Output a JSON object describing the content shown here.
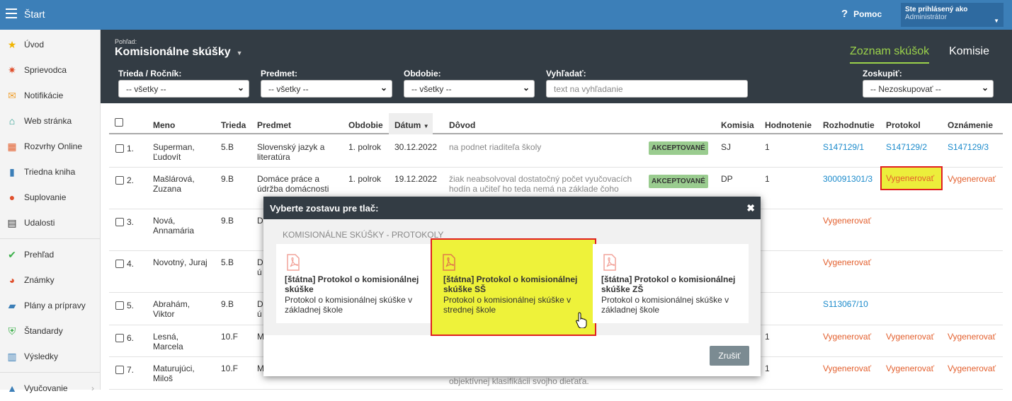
{
  "topbar": {
    "title": "Štart",
    "help": "Pomoc",
    "user_label": "Ste prihlásený ako",
    "user_name": "Administrátor"
  },
  "sidebar": {
    "items": [
      {
        "label": "Úvod",
        "icon": "star-icon",
        "color": "#f0b400"
      },
      {
        "label": "Sprievodca",
        "icon": "magic-wand-icon",
        "color": "#e0502d"
      },
      {
        "label": "Notifikácie",
        "icon": "envelope-icon",
        "color": "#f0a030"
      },
      {
        "label": "Web stránka",
        "icon": "home-icon",
        "color": "#2a9d8f"
      },
      {
        "label": "Rozvrhy Online",
        "icon": "calendar-grid-icon",
        "color": "#e35f2d"
      },
      {
        "label": "Triedna kniha",
        "icon": "book-icon",
        "color": "#3c7fb8"
      },
      {
        "label": "Suplovanie",
        "icon": "user-icon",
        "color": "#e0502d"
      },
      {
        "label": "Udalosti",
        "icon": "calendar-icon",
        "color": "#333333"
      },
      {
        "label": "Prehľad",
        "icon": "check-circle-icon",
        "color": "#3cb04a"
      },
      {
        "label": "Známky",
        "icon": "chart-circle-icon",
        "color": "#e0502d"
      },
      {
        "label": "Plány a prípravy",
        "icon": "briefcase-icon",
        "color": "#3c7fb8"
      },
      {
        "label": "Štandardy",
        "icon": "shield-check-icon",
        "color": "#3cb04a"
      },
      {
        "label": "Výsledky",
        "icon": "bar-chart-icon",
        "color": "#3c7fb8"
      },
      {
        "label": "Vyučovanie",
        "icon": "school-icon",
        "color": "#3c7fb8"
      }
    ]
  },
  "header": {
    "view_label": "Pohľad:",
    "view_title": "Komisionálne skúšky",
    "tabs": [
      "Zoznam skúšok",
      "Komisie"
    ]
  },
  "filters": {
    "class_label": "Trieda / Ročník:",
    "class_value": "-- všetky --",
    "subject_label": "Predmet:",
    "subject_value": "-- všetky --",
    "period_label": "Obdobie:",
    "period_value": "-- všetky --",
    "search_label": "Vyhľadať:",
    "search_placeholder": "text na vyhľadanie",
    "group_label": "Zoskupiť:",
    "group_value": "-- Nezoskupovať --"
  },
  "table": {
    "headers": {
      "name": "Meno",
      "class": "Trieda",
      "subject": "Predmet",
      "period": "Obdobie",
      "date": "Dátum",
      "reason": "Dôvod",
      "committee": "Komisia",
      "grade": "Hodnotenie",
      "decision": "Rozhodnutie",
      "protocol": "Protokol",
      "notice": "Oznámenie"
    },
    "rows": [
      {
        "num": "1.",
        "name": "Superman, Ľudovít",
        "class": "5.B",
        "subject": "Slovenský jazyk a literatúra",
        "period": "1. polrok",
        "date": "30.12.2022",
        "reason": "na podnet riaditeľa školy",
        "status": "AKCEPTOVANÉ",
        "committee": "SJ",
        "grade": "1",
        "decision": "S147129/1",
        "protocol": "S147129/2",
        "notice": "S147129/3"
      },
      {
        "num": "2.",
        "name": "Mašlárová, Zuzana",
        "class": "9.B",
        "subject": "Domáce práce a údržba domácnosti",
        "period": "1. polrok",
        "date": "19.12.2022",
        "reason": "žiak neabsolvoval dostatočný počet vyučovacích hodín a učiteľ ho teda nemá na základe čoho",
        "status": "AKCEPTOVANÉ",
        "committee": "DP",
        "grade": "1",
        "decision": "300091301/3",
        "protocol": "Vygenerovať",
        "notice": "Vygenerovať"
      },
      {
        "num": "3.",
        "name": "Nová, Annamária",
        "class": "9.B",
        "subject": "D",
        "decision": "Vygenerovať"
      },
      {
        "num": "4.",
        "name": "Novotný, Juraj",
        "class": "5.B",
        "subject": "D",
        "subject2": "ú",
        "decision": "Vygenerovať"
      },
      {
        "num": "5.",
        "name": "Abrahám, Viktor",
        "class": "9.B",
        "subject": "D",
        "subject2": "ú",
        "decision": "S113067/10"
      },
      {
        "num": "6.",
        "name": "Lesná, Marcela",
        "class": "10.F",
        "subject": "M",
        "grade": "1",
        "decision": "Vygenerovať",
        "protocol": "Vygenerovať",
        "notice": "Vygenerovať"
      },
      {
        "num": "7.",
        "name": "Maturujúci, Miloš",
        "class": "10.F",
        "subject": "M",
        "reason": "objektívnej klasifikácii svojho dieťaťa.",
        "grade": "1",
        "decision": "Vygenerovať",
        "protocol": "Vygenerovať",
        "notice": "Vygenerovať"
      }
    ]
  },
  "modal": {
    "title": "Vyberte zostavu pre tlač:",
    "section": "KOMISIONÁLNE SKÚŠKY - PROTOKOLY",
    "cards": [
      {
        "title": "[štátna] Protokol o komisionálnej skúške",
        "desc": "Protokol o komisionálnej skúške v základnej škole"
      },
      {
        "title": "[štátna] Protokol o komisionálnej skúške SŠ",
        "desc": "Protokol o komisionálnej skúške v strednej škole"
      },
      {
        "title": "[štátna] Protokol o komisionálnej skúške ZŠ",
        "desc": "Protokol o komisionálnej skúške v základnej škole"
      }
    ],
    "cancel": "Zrušiť"
  }
}
